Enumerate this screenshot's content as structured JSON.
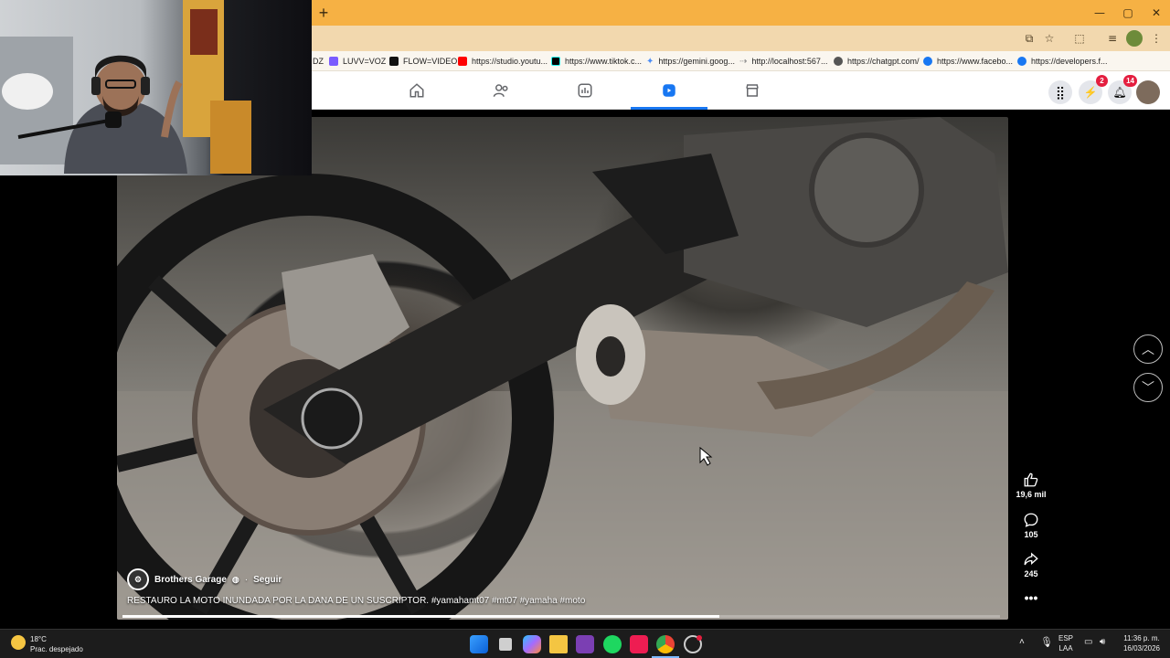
{
  "window": {
    "new_tab_glyph": "+",
    "controls": {
      "minimize": "—",
      "maximize": "▢",
      "close": "✕"
    }
  },
  "toolbar": {
    "icons": [
      "install-app-icon",
      "bookmark-star-icon",
      "extensions-icon",
      "media-control-icon",
      "profile-icon",
      "menu-icon"
    ]
  },
  "bookmarks": [
    {
      "label": "DZ",
      "color": "#888888"
    },
    {
      "label": "LUVV=VOZ",
      "color": "#7a5cff"
    },
    {
      "label": "FLOW=VIDEO",
      "color": "#111111"
    },
    {
      "label": "https://studio.youtu...",
      "color": "#ff0000"
    },
    {
      "label": "https://www.tiktok.c...",
      "color": "#000000"
    },
    {
      "label": "https://gemini.goog...",
      "color": "#4c8df6"
    },
    {
      "label": "http://localhost:567...",
      "color": "#888888"
    },
    {
      "label": "https://chatgpt.com/",
      "color": "#555555"
    },
    {
      "label": "https://www.facebo...",
      "color": "#1877f2"
    },
    {
      "label": "https://developers.f...",
      "color": "#1877f2"
    }
  ],
  "fbnav": {
    "tabs": [
      "home",
      "friends",
      "dashboard",
      "reels",
      "marketplace"
    ],
    "active_tab": "reels",
    "messenger_badge": "2",
    "notifications_badge": "14"
  },
  "video": {
    "channel_name": "Brothers Garage",
    "separator": "·",
    "follow_label": "Seguir",
    "caption": "RESTAURO LA MOTO INUNDADA POR LA DANA DE UN SUSCRIPTOR. #yamahamt07 #mt07 #yamaha #moto",
    "progress_fraction": 0.68,
    "likes": "19,6 mil",
    "comments": "105",
    "shares": "245"
  },
  "taskbar": {
    "weather_temp": "18°C",
    "weather_desc": "Prac. despejado",
    "lang_line1": "ESP",
    "lang_line2": "LAA",
    "time": "11:36 p. m.",
    "date": "16/03/2026",
    "apps": [
      "windows-start",
      "task-view",
      "copilot",
      "file-explorer",
      "app-purple",
      "spotify",
      "tiktok",
      "chrome",
      "app-record"
    ]
  },
  "colors": {
    "titlebar": "#f6b144",
    "toolbar": "#f2d8ae",
    "fb_blue": "#1877f2",
    "badge_red": "#e41e3f"
  }
}
